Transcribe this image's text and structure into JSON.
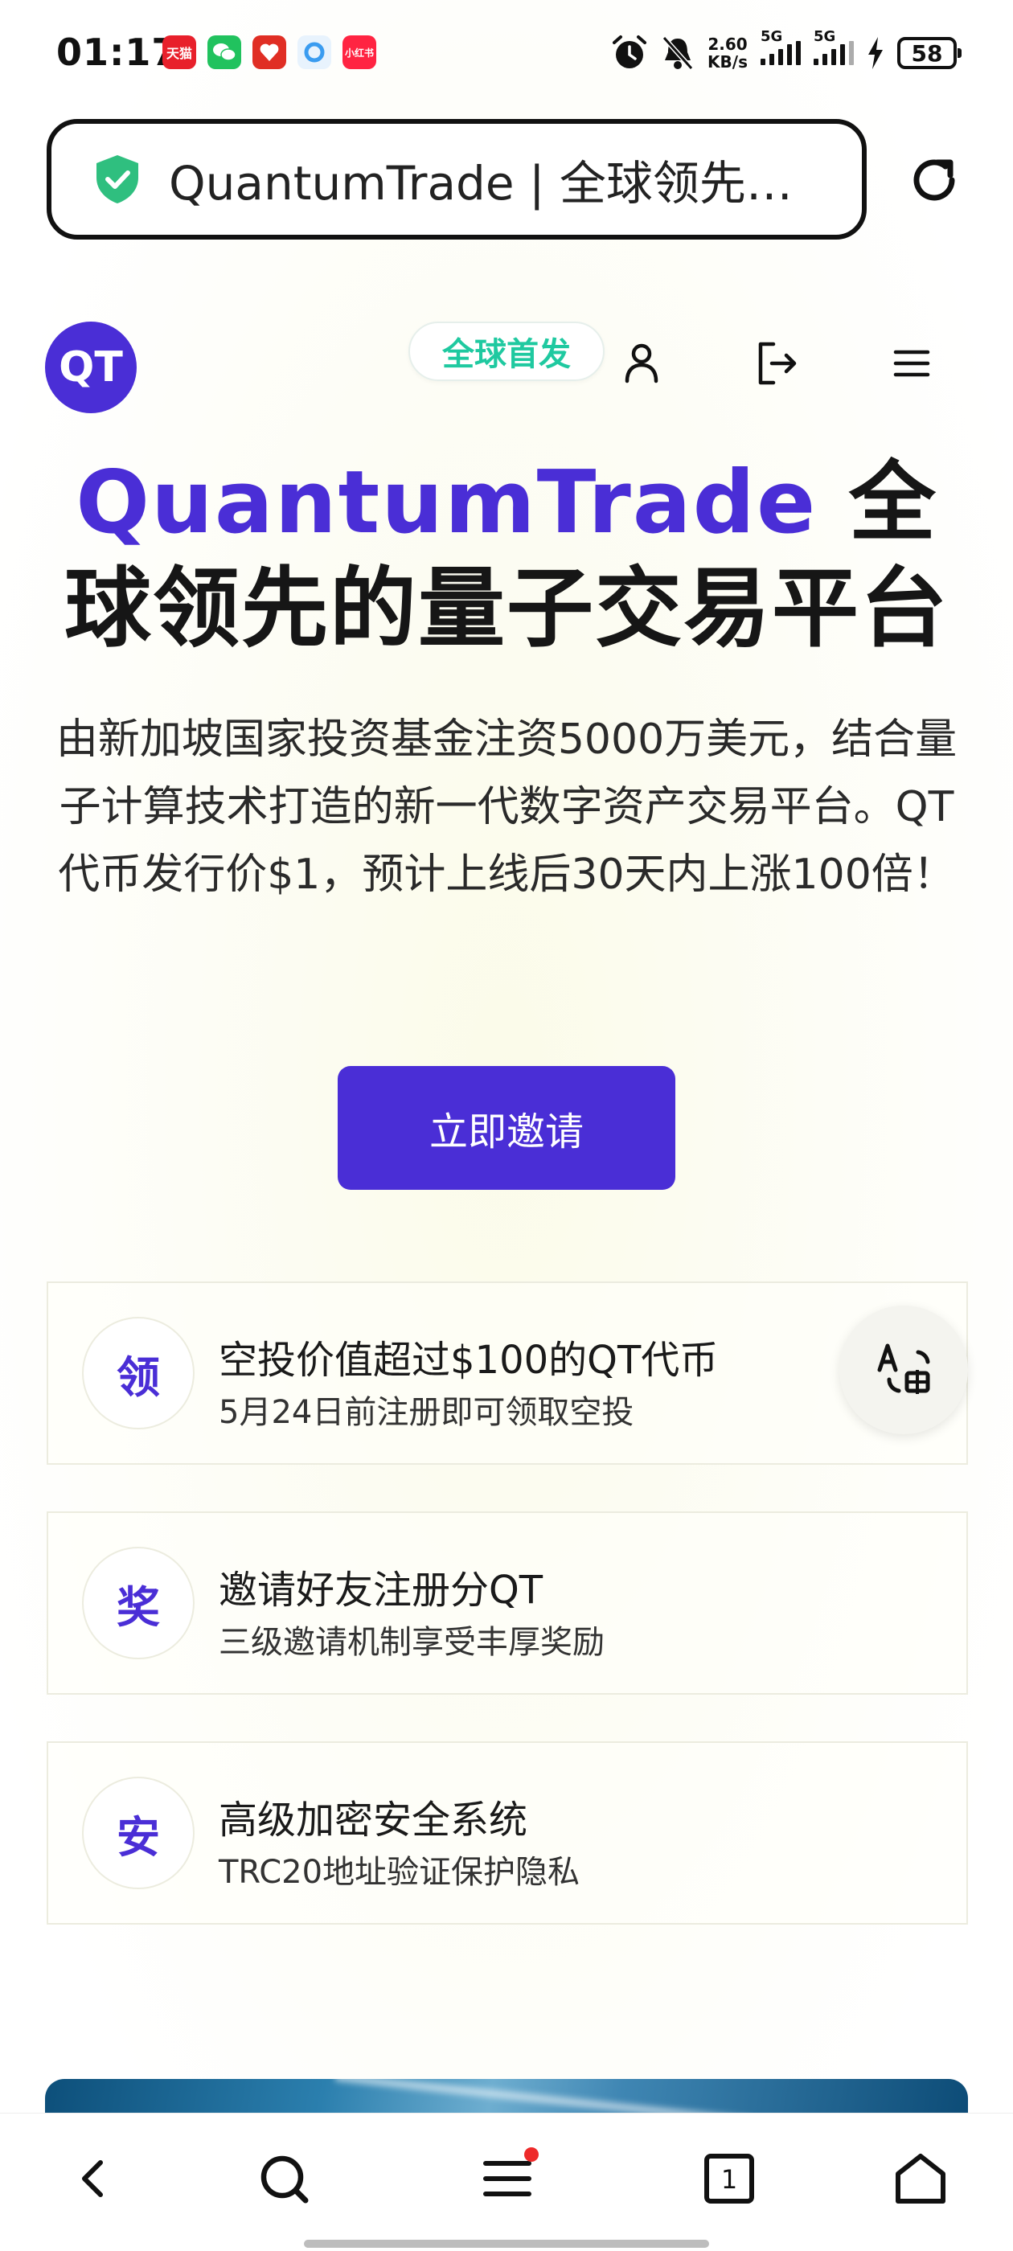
{
  "status_bar": {
    "time": "01:17",
    "apps": [
      {
        "name": "tmall-icon",
        "label": "天猫",
        "color": "#e8202b"
      },
      {
        "name": "wechat-icon",
        "label": "",
        "color": "#21c25e"
      },
      {
        "name": "pinduoduo-icon",
        "label": "",
        "color": "#e02e24"
      },
      {
        "name": "browser-icon",
        "label": "",
        "color": "#3a9cf0"
      },
      {
        "name": "xiaohongshu-icon",
        "label": "小红书",
        "color": "#ff2442"
      }
    ],
    "net_speed_value": "2.60",
    "net_speed_unit": "KB/s",
    "signal1_label": "5G",
    "signal2_label": "5G",
    "battery": "58"
  },
  "browser": {
    "url_text": "QuantumTrade | 全球领先的…"
  },
  "header": {
    "logo": "QT",
    "badge": "全球首发"
  },
  "hero": {
    "title_brand": "QuantumTrade",
    "title_rest": " 全球领先的量子交易平台",
    "description": "由新加坡国家投资基金注资5000万美元，结合量子计算技术打造的新一代数字资产交易平台。QT代币发行价$1，预计上线后30天内上涨100倍！",
    "cta": "立即邀请"
  },
  "features": [
    {
      "icon_char": "领",
      "title": "空投价值超过$100的QT代币",
      "subtitle": "5月24日前注册即可领取空投"
    },
    {
      "icon_char": "奖",
      "title": "邀请好友注册分QT",
      "subtitle": "三级邀请机制享受丰厚奖励"
    },
    {
      "icon_char": "安",
      "title": "高级加密安全系统",
      "subtitle": "TRC20地址验证保护隐私"
    }
  ],
  "nav": {
    "tab_count": "1"
  },
  "colors": {
    "brand": "#4a2ed6",
    "badge_text": "#1fc9a0",
    "shield": "#2fbf7f",
    "notification": "#ee2a2a"
  }
}
